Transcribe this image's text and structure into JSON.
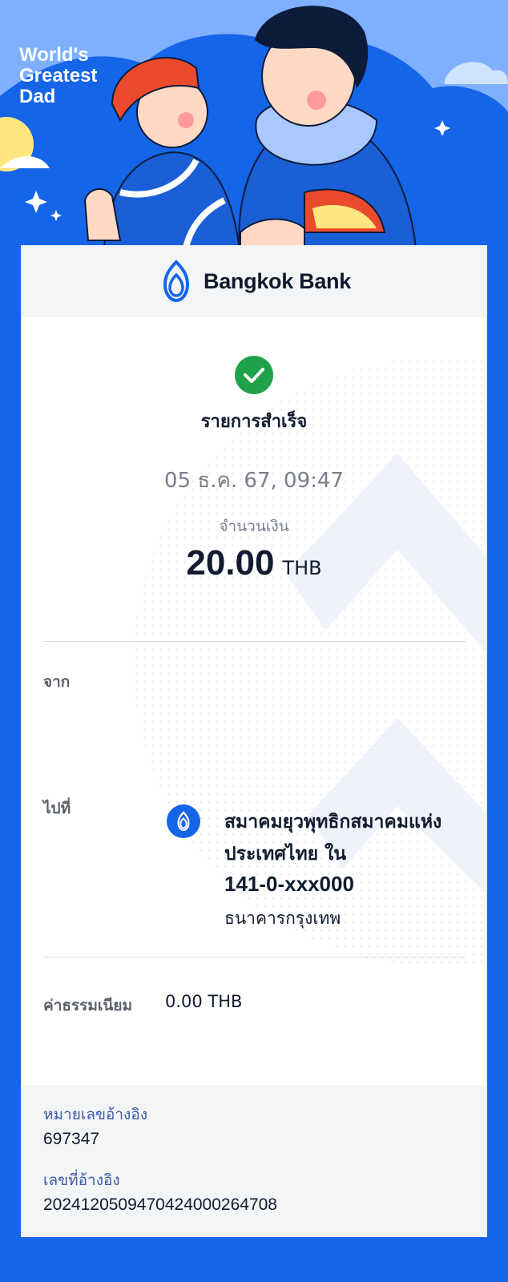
{
  "hero": {
    "caption": "World's\nGreatest\nDad"
  },
  "brand": {
    "name": "Bangkok Bank"
  },
  "transaction": {
    "status": "รายการสำเร็จ",
    "datetime": "05 ธ.ค. 67, 09:47",
    "amount_label": "จำนวนเงิน",
    "amount": "20.00",
    "currency": "THB"
  },
  "from": {
    "label": "จาก"
  },
  "to": {
    "label": "ไปที่",
    "name": "สมาคมยุวพุทธิกสมาคมแห่งประเทศไทย ใน",
    "account": "141-0-xxx000",
    "bank": "ธนาคารกรุงเทพ"
  },
  "fee": {
    "label": "ค่าธรรมเนียม",
    "value": "0.00 THB"
  },
  "reference": {
    "ref1_label": "หมายเลขอ้างอิง",
    "ref1_value": "697347",
    "ref2_label": "เลขที่อ้างอิง",
    "ref2_value": "2024120509470424000264708"
  },
  "colors": {
    "accent": "#1565e8",
    "success": "#1fa24a",
    "hero_sky": "#7fb0ff"
  }
}
